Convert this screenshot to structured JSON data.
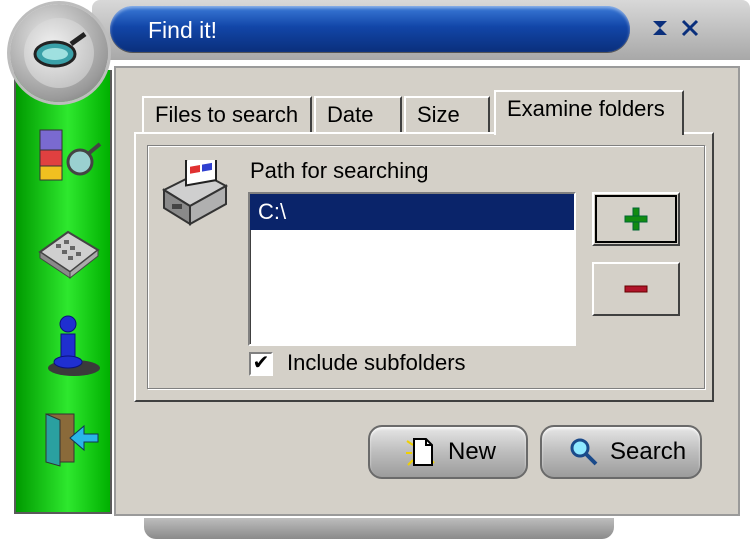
{
  "window": {
    "title": "Find it!"
  },
  "tabs": [
    {
      "label": "Files to search"
    },
    {
      "label": "Date"
    },
    {
      "label": "Size"
    },
    {
      "label": "Examine folders"
    }
  ],
  "panel": {
    "path_label": "Path for searching",
    "paths": [
      "C:\\"
    ],
    "include_subfolders_label": "Include subfolders",
    "include_subfolders_checked": true,
    "include_subfolders_mark": "✔"
  },
  "buttons": {
    "add_symbol": "+",
    "remove_symbol": "−",
    "new_label": "New",
    "search_label": "Search"
  },
  "sidebar": {
    "icons": [
      "search-files-icon",
      "calculator-icon",
      "info-icon",
      "exit-door-icon"
    ]
  },
  "colors": {
    "title_blue": "#1246a8",
    "sidebar_green": "#2ee82e",
    "selection": "#0a246a",
    "add_green": "#118c11",
    "remove_red": "#b0142a"
  }
}
